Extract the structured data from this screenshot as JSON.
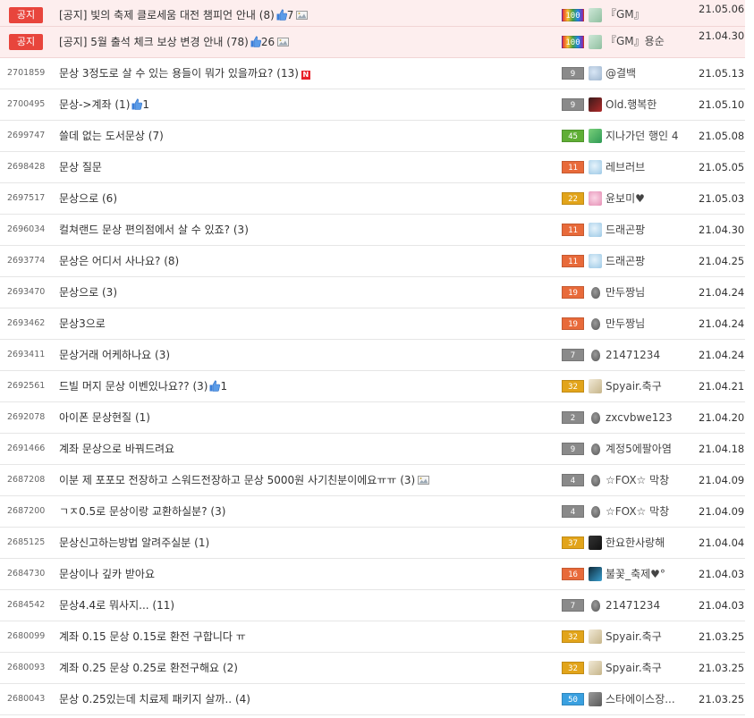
{
  "colors": {
    "notice_bg": "#fdeeee",
    "notice_badge": "#e8453c",
    "level_gray": "#8a8a8a",
    "level_red": "#e86a3a",
    "level_gold": "#e2a41a",
    "level_green": "#5fae35",
    "level_blue": "#3aa0e0"
  },
  "rows": [
    {
      "type": "notice",
      "badge": "공지",
      "title": "[공지] 빛의 축제 클로세움 대전 챔피언 안내",
      "count": "(8)",
      "likes": "7",
      "image": true,
      "level": "100",
      "level_color": "rainbow",
      "avatar": "gm",
      "nick": "『GM』",
      "date": "21.05.06"
    },
    {
      "type": "notice",
      "badge": "공지",
      "title": "[공지] 5월 출석 체크 보상 변경 안내",
      "count": "(78)",
      "likes": "26",
      "image": true,
      "level": "100",
      "level_color": "rainbow",
      "avatar": "gm",
      "nick": "『GM』용순",
      "date": "21.04.30"
    },
    {
      "type": "post",
      "num": "2701859",
      "title": "문상 3정도로 살 수 있는 용들이 뭐가 있을까요?",
      "count": "(13)",
      "new": "N",
      "level": "9",
      "level_color": "gray",
      "avatar": "cloud",
      "nick": "@결백",
      "date": "21.05.13"
    },
    {
      "type": "post",
      "num": "2700495",
      "title": "문상->계좌",
      "count": "(1)",
      "likes": "1",
      "level": "9",
      "level_color": "gray",
      "avatar": "dark",
      "nick": "Old.행복한",
      "date": "21.05.10"
    },
    {
      "type": "post",
      "num": "2699747",
      "title": "쓸데 없는 도서문상",
      "count": "(7)",
      "level": "45",
      "level_color": "green",
      "avatar": "green",
      "nick": "지나가던 행인 4",
      "date": "21.05.08"
    },
    {
      "type": "post",
      "num": "2698428",
      "title": "문상 질문",
      "count": "",
      "level": "11",
      "level_color": "red",
      "avatar": "ice",
      "nick": "레브러브",
      "date": "21.05.05"
    },
    {
      "type": "post",
      "num": "2697517",
      "title": "문상으로",
      "count": "(6)",
      "level": "22",
      "level_color": "gold",
      "avatar": "pink",
      "nick": "윤보미♥",
      "date": "21.05.03"
    },
    {
      "type": "post",
      "num": "2696034",
      "title": "컬쳐랜드 문상 편의점에서 살 수 있죠?",
      "count": "(3)",
      "level": "11",
      "level_color": "red",
      "avatar": "ice",
      "nick": "드래곤팡",
      "date": "21.04.30"
    },
    {
      "type": "post",
      "num": "2693774",
      "title": "문상은 어디서 사나요?",
      "count": "(8)",
      "level": "11",
      "level_color": "red",
      "avatar": "ice",
      "nick": "드래곤팡",
      "date": "21.04.25"
    },
    {
      "type": "post",
      "num": "2693470",
      "title": "문상으로",
      "count": "(3)",
      "level": "19",
      "level_color": "red",
      "avatar": "egg",
      "nick": "만두짱님",
      "date": "21.04.24"
    },
    {
      "type": "post",
      "num": "2693462",
      "title": "문상3으로",
      "count": "",
      "level": "19",
      "level_color": "red",
      "avatar": "egg",
      "nick": "만두짱님",
      "date": "21.04.24"
    },
    {
      "type": "post",
      "num": "2693411",
      "title": "문상거래 어케하나요",
      "count": "(3)",
      "level": "7",
      "level_color": "gray",
      "avatar": "egg",
      "nick": "21471234",
      "date": "21.04.24"
    },
    {
      "type": "post",
      "num": "2692561",
      "title": "드빌 머지 문상 이벤있나요??",
      "count": "(3)",
      "likes": "1",
      "level": "32",
      "level_color": "gold",
      "avatar": "wing",
      "nick": "Spyair.축구",
      "date": "21.04.21"
    },
    {
      "type": "post",
      "num": "2692078",
      "title": "아이폰 문상현질",
      "count": "(1)",
      "level": "2",
      "level_color": "gray",
      "avatar": "egg",
      "nick": "zxcvbwe123",
      "date": "21.04.20"
    },
    {
      "type": "post",
      "num": "2691466",
      "title": "계좌 문상으로 바꿔드려요",
      "count": "",
      "level": "9",
      "level_color": "gray",
      "avatar": "egg",
      "nick": "계정5에팔아염",
      "date": "21.04.18"
    },
    {
      "type": "post",
      "num": "2687208",
      "title": "이분 제 포포모 전장하고 스워드전장하고 문상 5000원 사기친분이에요ㅠㅠ",
      "count": "(3)",
      "image": true,
      "level": "4",
      "level_color": "gray",
      "avatar": "egg",
      "nick": "☆FOX☆ 막창",
      "date": "21.04.09"
    },
    {
      "type": "post",
      "num": "2687200",
      "title": "ㄱㅈ0.5로 문상이랑 교환하실분?",
      "count": "(3)",
      "level": "4",
      "level_color": "gray",
      "avatar": "egg",
      "nick": "☆FOX☆ 막창",
      "date": "21.04.09"
    },
    {
      "type": "post",
      "num": "2685125",
      "title": "문상신고하는방법 알려주실분",
      "count": "(1)",
      "level": "37",
      "level_color": "gold",
      "avatar": "black",
      "nick": "한요한사랑해",
      "date": "21.04.04"
    },
    {
      "type": "post",
      "num": "2684730",
      "title": "문상이나 깊카 받아요",
      "count": "",
      "level": "16",
      "level_color": "red",
      "avatar": "night",
      "nick": "불꽃_축제♥°",
      "date": "21.04.03"
    },
    {
      "type": "post",
      "num": "2684542",
      "title": "문상4.4로 뭐사지...",
      "count": "(11)",
      "level": "7",
      "level_color": "gray",
      "avatar": "egg",
      "nick": "21471234",
      "date": "21.04.03"
    },
    {
      "type": "post",
      "num": "2680099",
      "title": "계좌 0.15 문상 0.15로 환전 구합니다 ㅠ",
      "count": "",
      "level": "32",
      "level_color": "gold",
      "avatar": "wing",
      "nick": "Spyair.축구",
      "date": "21.03.25"
    },
    {
      "type": "post",
      "num": "2680093",
      "title": "계좌 0.25 문상 0.25로 환전구해요",
      "count": "(2)",
      "level": "32",
      "level_color": "gold",
      "avatar": "wing",
      "nick": "Spyair.축구",
      "date": "21.03.25"
    },
    {
      "type": "post",
      "num": "2680043",
      "title": "문상 0.25있는데 치료제 패키지 살까..",
      "count": "(4)",
      "level": "50",
      "level_color": "blue",
      "avatar": "gray",
      "nick": "스타에이스장...",
      "date": "21.03.25"
    }
  ]
}
